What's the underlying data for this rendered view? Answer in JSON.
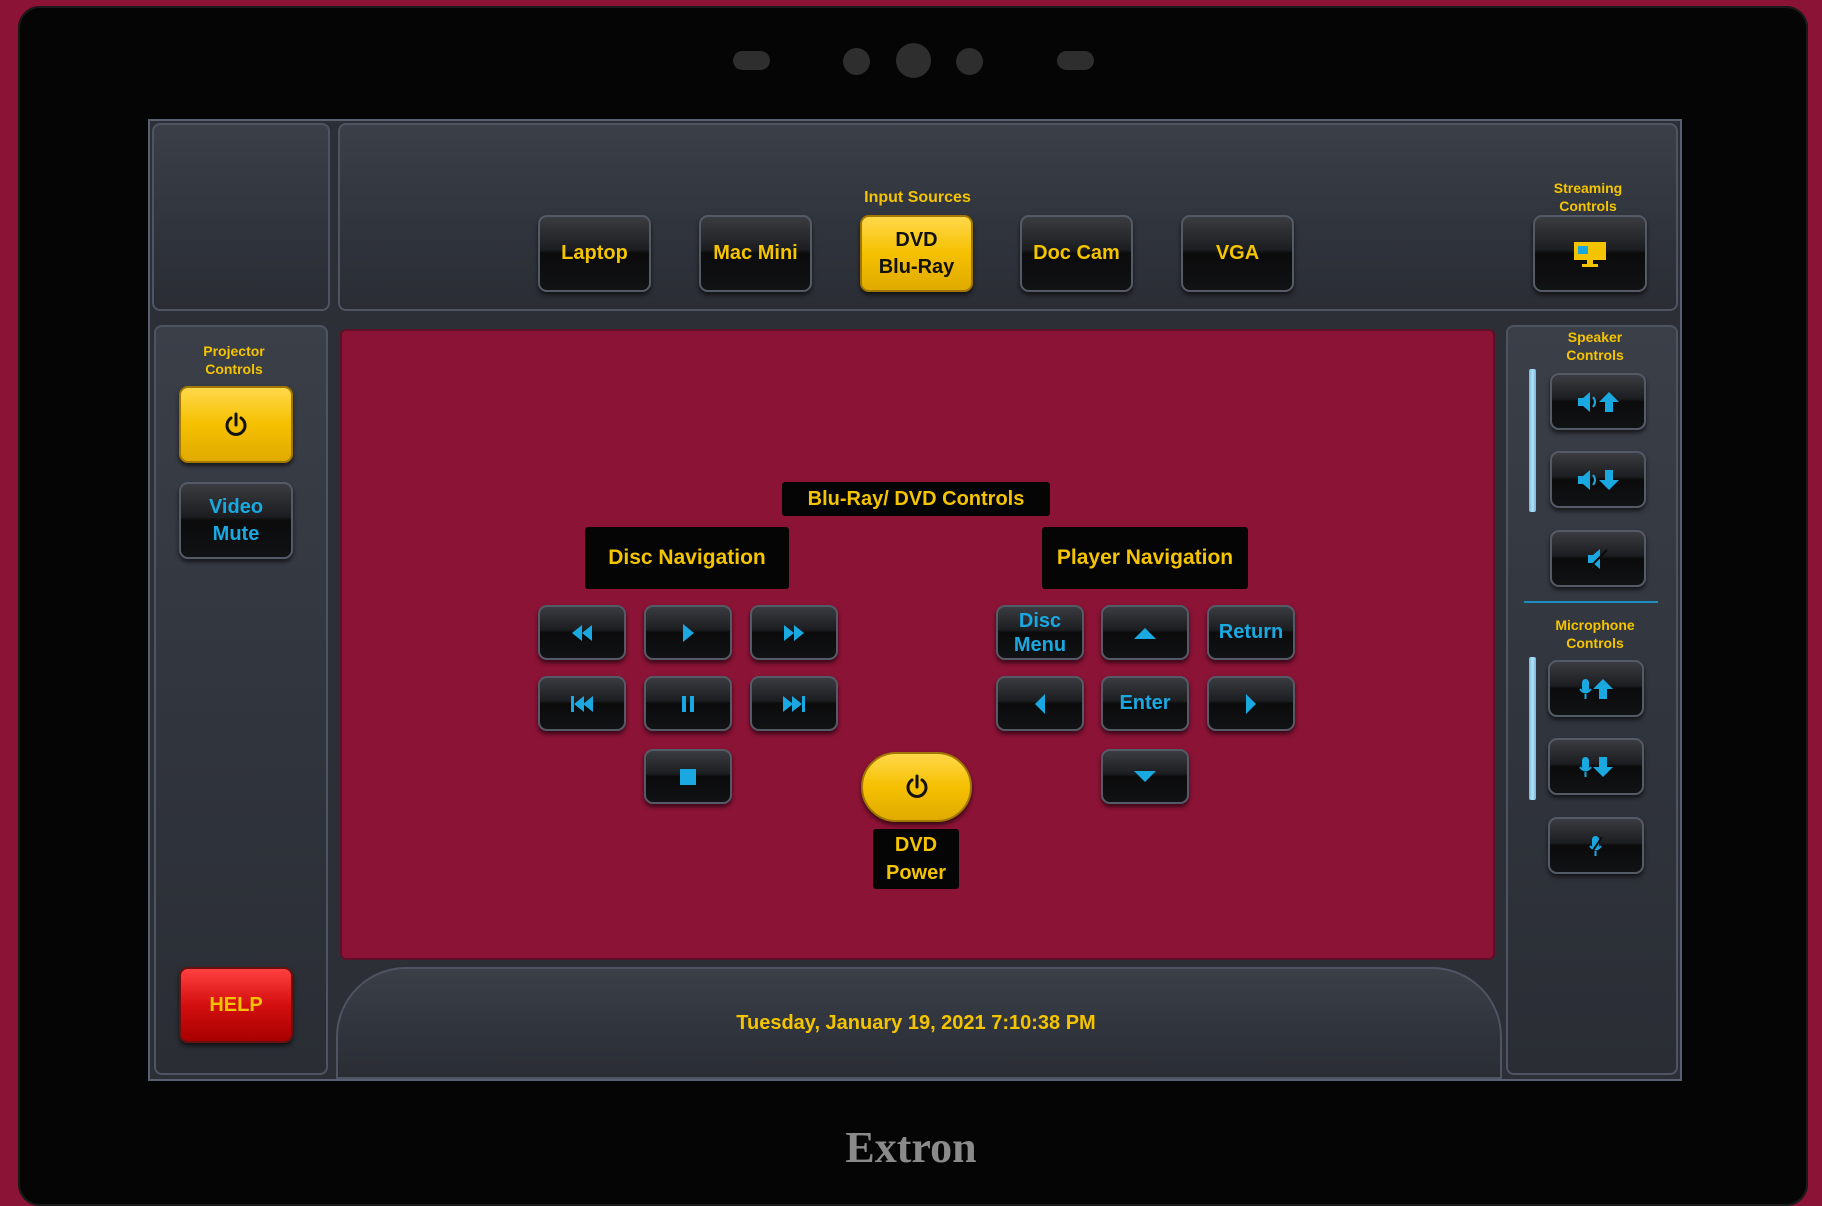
{
  "device": {
    "brand": "Extron"
  },
  "inputs": {
    "title": "Input Sources",
    "sources": [
      {
        "label": "Laptop",
        "active": false
      },
      {
        "label": "Mac Mini",
        "active": false
      },
      {
        "label": "DVD\nBlu-Ray",
        "active": true
      },
      {
        "label": "Doc Cam",
        "active": false
      },
      {
        "label": "VGA",
        "active": false
      }
    ]
  },
  "streaming": {
    "title": "Streaming\nControls",
    "icon": "monitor-icon"
  },
  "projector": {
    "title": "Projector\nControls",
    "power_icon": "power-icon",
    "video_mute_line1": "Video",
    "video_mute_line2": "Mute"
  },
  "help": {
    "label": "HELP"
  },
  "dvd": {
    "title": "Blu-Ray/ DVD Controls",
    "disc_nav_title": "Disc Navigation",
    "player_nav_title": "Player Navigation",
    "disc_buttons": [
      "rewind-icon",
      "play-icon",
      "fast-forward-icon",
      "previous-track-icon",
      "pause-icon",
      "next-track-icon",
      "stop-icon"
    ],
    "player": {
      "disc_menu": "Disc\nMenu",
      "return": "Return",
      "enter": "Enter"
    },
    "power_label": "DVD\nPower"
  },
  "speaker": {
    "title": "Speaker\nControls",
    "buttons": [
      "volume-up-icon",
      "volume-down-icon",
      "mute-icon"
    ]
  },
  "microphone": {
    "title": "Microphone\nControls",
    "buttons": [
      "mic-up-icon",
      "mic-down-icon",
      "mic-mute-icon"
    ]
  },
  "status": {
    "datetime": "Tuesday, January 19, 2021 7:10:38 PM"
  },
  "colors": {
    "accent": "#f5c400",
    "cyan": "#1aa8e0",
    "background": "#8b1336"
  }
}
